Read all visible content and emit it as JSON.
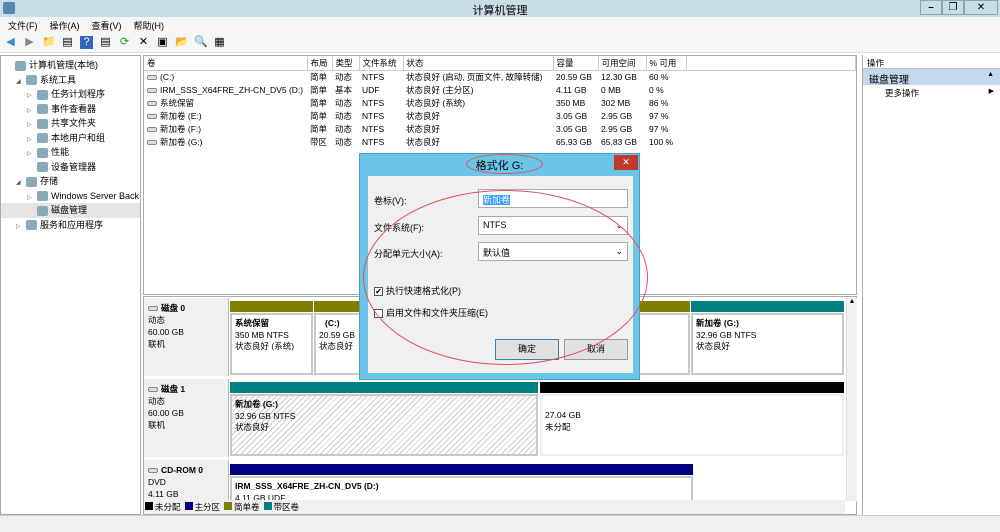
{
  "window": {
    "title": "计算机管理",
    "minimize": "–",
    "restore": "❐",
    "close": "✕"
  },
  "menu": [
    "文件(F)",
    "操作(A)",
    "查看(V)",
    "帮助(H)"
  ],
  "toolbar": [
    "◀",
    "▶",
    "📁",
    "▤",
    "?",
    "▤",
    "⟳",
    "✕",
    "▣",
    "📂",
    "🔍",
    "▦"
  ],
  "tree": [
    {
      "label": "计算机管理(本地)",
      "indent": 0,
      "arrow": ""
    },
    {
      "label": "系统工具",
      "indent": 1,
      "arrow": "◢"
    },
    {
      "label": "任务计划程序",
      "indent": 2,
      "arrow": "▷"
    },
    {
      "label": "事件查看器",
      "indent": 2,
      "arrow": "▷"
    },
    {
      "label": "共享文件夹",
      "indent": 2,
      "arrow": "▷"
    },
    {
      "label": "本地用户和组",
      "indent": 2,
      "arrow": "▷"
    },
    {
      "label": "性能",
      "indent": 2,
      "arrow": "▷"
    },
    {
      "label": "设备管理器",
      "indent": 2,
      "arrow": ""
    },
    {
      "label": "存储",
      "indent": 1,
      "arrow": "◢"
    },
    {
      "label": "Windows Server Back",
      "indent": 2,
      "arrow": "▷"
    },
    {
      "label": "磁盘管理",
      "indent": 2,
      "arrow": ""
    },
    {
      "label": "服务和应用程序",
      "indent": 1,
      "arrow": "▷"
    }
  ],
  "volumes": {
    "headers": [
      "卷",
      "布局",
      "类型",
      "文件系统",
      "状态",
      "容量",
      "可用空间",
      "% 可用"
    ],
    "rows": [
      [
        "(C:)",
        "简单",
        "动态",
        "NTFS",
        "状态良好 (启动, 页面文件, 故障转储)",
        "20.59 GB",
        "12.30 GB",
        "60 %"
      ],
      [
        "IRM_SSS_X64FRE_ZH-CN_DV5 (D:)",
        "简单",
        "基本",
        "UDF",
        "状态良好 (主分区)",
        "4.11 GB",
        "0 MB",
        "0 %"
      ],
      [
        "系统保留",
        "简单",
        "动态",
        "NTFS",
        "状态良好 (系统)",
        "350 MB",
        "302 MB",
        "86 %"
      ],
      [
        "新加卷 (E:)",
        "简单",
        "动态",
        "NTFS",
        "状态良好",
        "3.05 GB",
        "2.95 GB",
        "97 %"
      ],
      [
        "新加卷 (F:)",
        "简单",
        "动态",
        "NTFS",
        "状态良好",
        "3.05 GB",
        "2.95 GB",
        "97 %"
      ],
      [
        "新加卷 (G:)",
        "带区",
        "动态",
        "NTFS",
        "状态良好",
        "65.93 GB",
        "65.83 GB",
        "100 %"
      ]
    ]
  },
  "actions": {
    "header": "操作",
    "section": "磁盘管理",
    "more": "更多操作"
  },
  "disks": [
    {
      "name": "磁盘 0",
      "type": "动态",
      "size": "60.00 GB",
      "state": "联机",
      "parts": [
        {
          "name": "系统保留",
          "size": "350 MB NTFS",
          "status": "状态良好 (系统)"
        },
        {
          "name": "(C:)",
          "size": "20.59 GB",
          "status": "状态良好"
        },
        {
          "name": "新加卷  (G:)",
          "size": "32.96 GB NTFS",
          "status": "状态良好"
        }
      ]
    },
    {
      "name": "磁盘 1",
      "type": "动态",
      "size": "60.00 GB",
      "state": "联机",
      "parts": [
        {
          "name": "新加卷  (G:)",
          "size": "32.96 GB NTFS",
          "status": "状态良好"
        },
        {
          "name": "",
          "size": "27.04 GB",
          "status": "未分配"
        }
      ]
    },
    {
      "name": "CD-ROM 0",
      "type": "DVD",
      "size": "4.11 GB",
      "parts": [
        {
          "name": "IRM_SSS_X64FRE_ZH-CN_DV5  (D:)",
          "size": "4.11 GB UDF"
        }
      ]
    }
  ],
  "legend": [
    {
      "label": "未分配",
      "color": "#000000"
    },
    {
      "label": "主分区",
      "color": "#000080"
    },
    {
      "label": "简单卷",
      "color": "#808000"
    },
    {
      "label": "带区卷",
      "color": "#008080"
    }
  ],
  "dialog": {
    "title": "格式化 G:",
    "close": "✕",
    "label_volume": "卷标(V):",
    "volume_value": "新加卷",
    "label_fs": "文件系统(F):",
    "fs_value": "NTFS",
    "label_alloc": "分配单元大小(A):",
    "alloc_value": "默认值",
    "quick_format": "执行快速格式化(P)",
    "quick_checked": "✔",
    "compress": "启用文件和文件夹压缩(E)",
    "ok": "确定",
    "cancel": "取消"
  }
}
